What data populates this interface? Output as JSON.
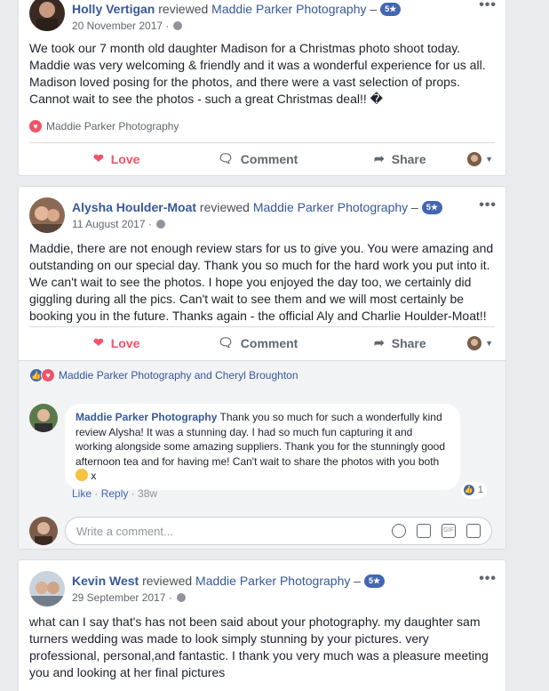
{
  "posts": [
    {
      "name": "Holly Vertigan",
      "verb": " reviewed ",
      "page": "Maddie Parker Photography",
      "dash": " –",
      "stars": "5★",
      "date": "20 November 2017 ·",
      "text": "We took our 7 month old daughter Madison for a Christmas photo shoot today. Maddie was very welcoming & friendly and it was a wonderful experience for us all. Madison loved posing for the photos, and there were a vast selection of props. Cannot wait to see the photos - such a great Christmas deal!! �",
      "tag": "Maddie Parker Photography"
    },
    {
      "name": "Alysha Houlder-Moat",
      "verb": " reviewed ",
      "page": "Maddie Parker Photography",
      "dash": " –",
      "stars": "5★",
      "date": "11 August 2017 ·",
      "text": "Maddie, there are not enough review stars for us to give you. You were amazing and outstanding on our special day. Thank you so much for the hard work you put into it. We can't wait to see the photos. I hope you enjoyed the day too, we certainly did giggling during all the pics. Can't wait to see them and we will most certainly be booking you in the future. Thanks again - the official Aly and Charlie Houlder-Moat!!"
    },
    {
      "name": "Kevin West",
      "verb": " reviewed ",
      "page": "Maddie Parker Photography",
      "dash": " –",
      "stars": "5★",
      "date": "29 September 2017 ·",
      "text": "what can I say that's has not been said about your photography. my daughter sam turners wedding was made to look simply stunning by your pictures. very professional, personal,and fantastic. I thank you very much was a pleasure meeting you and looking at her final pictures"
    }
  ],
  "actions": {
    "love": "Love",
    "comment": "Comment",
    "share": "Share"
  },
  "more_label": "•••",
  "reactions_line": "Maddie Parker Photography and Cheryl Broughton",
  "reply": {
    "name": "Maddie Parker Photography",
    "text": " Thank you so much for such a wonderfully kind review Alysha! It was a stunning day. I had so much fun capturing it and working alongside some amazing suppliers. Thank you for the stunningly good afternoon tea and for having me! Can't wait to share the photos with you both ",
    "tail": " x",
    "likes": "1",
    "like": "Like",
    "sep1": " · ",
    "reply_label": "Reply",
    "sep2": " · ",
    "time": "38w"
  },
  "composer": {
    "placeholder": "Write a comment...",
    "gif": "GIF"
  },
  "colors": {
    "love": "#f25268",
    "link": "#365899",
    "like": "#4267b2"
  }
}
